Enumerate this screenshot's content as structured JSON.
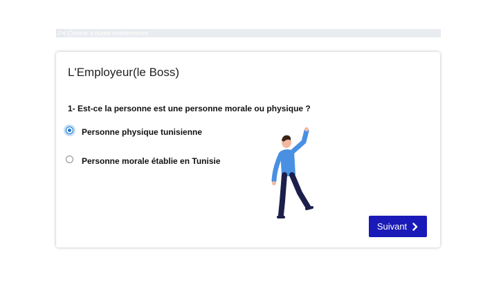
{
  "progress": {
    "label": "2% Contrat à durée indéterminée",
    "fraction": 0.02
  },
  "card": {
    "title": "L'Employeur(le Boss)",
    "question": "1- Est-ce la personne est une personne morale ou physique ?",
    "options": [
      {
        "label": "Personne physique tunisienne",
        "selected": true
      },
      {
        "label": "Personne morale établie en Tunisie",
        "selected": false
      }
    ],
    "next_label": "Suivant"
  },
  "colors": {
    "button": "#1a1ab8",
    "radio_selected": "#1976d2",
    "illustration_shirt": "#4a90e2",
    "illustration_pants": "#1c1f4a"
  },
  "icons": {
    "next": "chevron-right-icon",
    "illustration": "waving-person-illustration"
  }
}
